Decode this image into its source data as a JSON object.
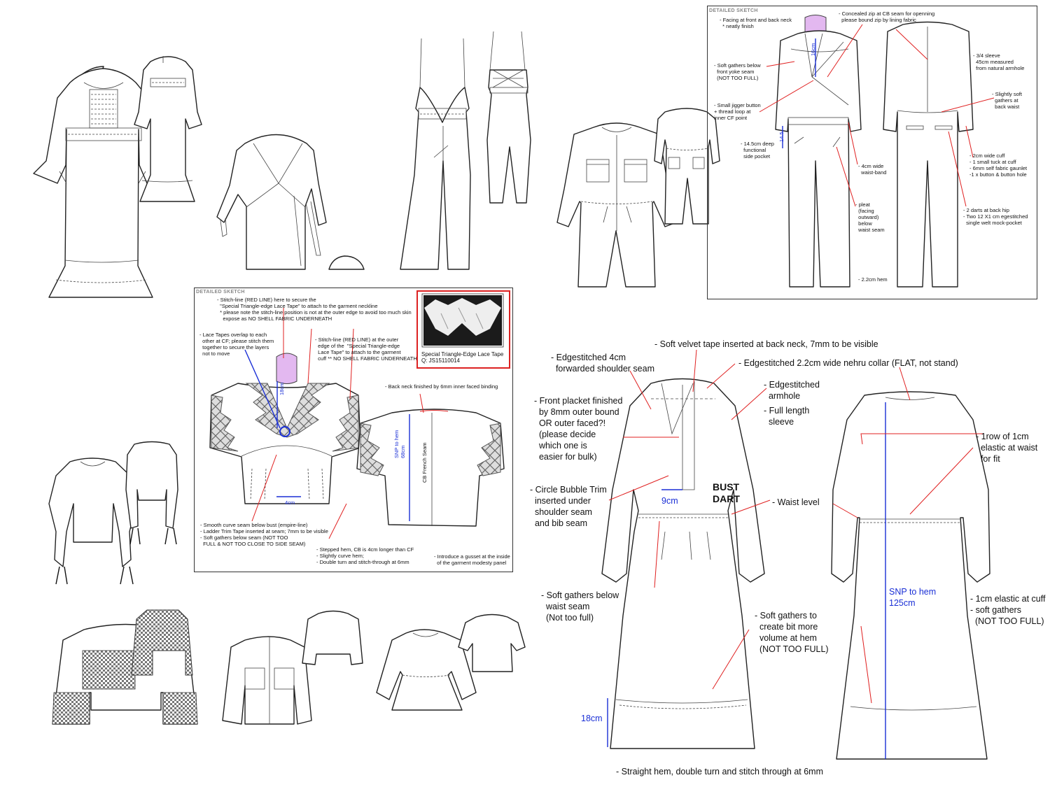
{
  "panel1": {
    "header": "DETAILED SKETCH",
    "notes": [
      "- Stitch-line (RED LINE) here to secure the\n  \"Special Triangle-edge Lace Tape\" to attach to the garment neckline\n  * please note the stitch-line position is not at the outer edge to avoid too much skin\n    expose as NO SHELL FABRIC UNDERNEATH",
      "- Lace Tapes overlap to each\n  other at CF; please stitch them\n  together to secure the layers\n  not to move",
      "- Stitch-line (RED LINE) at the outer\n  edge of the  \"Special Triangle-edge\n  Lace Tape\" to attach to the garment\n  cuff ** NO SHELL FABRIC UNDERNEATH",
      "- Back neck finished by 6mm inner faced binding",
      "- Smooth curve seam below bust (empire-line)\n- Ladder Trim Tape inserted at seam; 7mm to be visible\n- Soft gathers below seam (NOT TOO\n  FULL & NOT TOO CLOSE TO SIDE SEAM)",
      "- Stepped hem, CB is 4cm longer than CF\n- Slightly curve hem;\n- Double turn and stitch-through at 6mm",
      "- Introduce a gusset at the inside\n  of the garment modesty panel"
    ],
    "lace_caption": "Special Triangle-Edge Lace Tape\nQ: JS15110014",
    "dim_18cm": "18cm",
    "dim_4cm": "4cm",
    "dim_snp": "SNP to hem\n68cm",
    "cb_seam": "CB French Seam"
  },
  "panel2": {
    "header": "DETAILED SKETCH",
    "notes": [
      "- Facing at front and back neck\n  * neatly finish",
      "- Concealed zip at CB seam for openning\n  please bound zip by lining fabric",
      "- Soft gathers below\n  front yoke seam\n  (NOT TOO FULL)",
      "- 3/4 sleeve\n  45cm measured\n  from natural armhole",
      "- Slightly soft\n  gathers at\n  back waist",
      "- Small jigger button\n+ thread loop at\ninner CF point",
      "- 14.5cm deep\n  functional\n  side pocket",
      "- 4cm wide\n  waist-band",
      "- 2cm wide cuff\n- 1 small tuck at cuff\n- 6mm self fabric gaunlet\n-1 x button & button hole",
      "- pleat\n  (facing\n  outward)\n  below\n  waist seam",
      "- 2 darts at back hip\n- Two 12 X1 cm egestitched\n  single welt mock-pocket",
      "- 2.2cm hem"
    ],
    "dim_16cm": "16cm",
    "dim_145": "14.5"
  },
  "panel3": {
    "notes": [
      "- Soft velvet tape inserted at back neck, 7mm to be visible",
      "- Edgestitched 4cm\n  forwarded shoulder seam",
      "- Edgestitched 2.2cm wide nehru collar (FLAT, not stand)",
      "- Edgestitched\n  armhole",
      "- Full length\n  sleeve",
      "- Front placket finished\n  by 8mm outer bound\n  OR outer faced?!\n  (please decide\n  which one is\n  easier for bulk)",
      "- 1row of 1cm\n  elastic at waist\n  for fit",
      "- Circle Bubble Trim\n  inserted under\n  shoulder seam\n  and bib seam",
      "- Waist level",
      "- Soft gathers below\n  waist seam\n  (Not too full)",
      "- 1cm elastic at cuff\n- soft gathers\n  (NOT TOO FULL)",
      "- Soft gathers to\n  create bit more\n  volume at hem\n  (NOT TOO FULL)",
      "- Straight hem, double turn and stitch through at 6mm"
    ],
    "bust_dart": "BUST\nDART",
    "dim_9cm": "9cm",
    "dim_18cm": "18cm",
    "dim_snp": "SNP to hem\n125cm"
  },
  "colors": {
    "annotation_red": "#e02020",
    "dimension_blue": "#1a2fd6",
    "lace_frame_red": "#d22222"
  }
}
